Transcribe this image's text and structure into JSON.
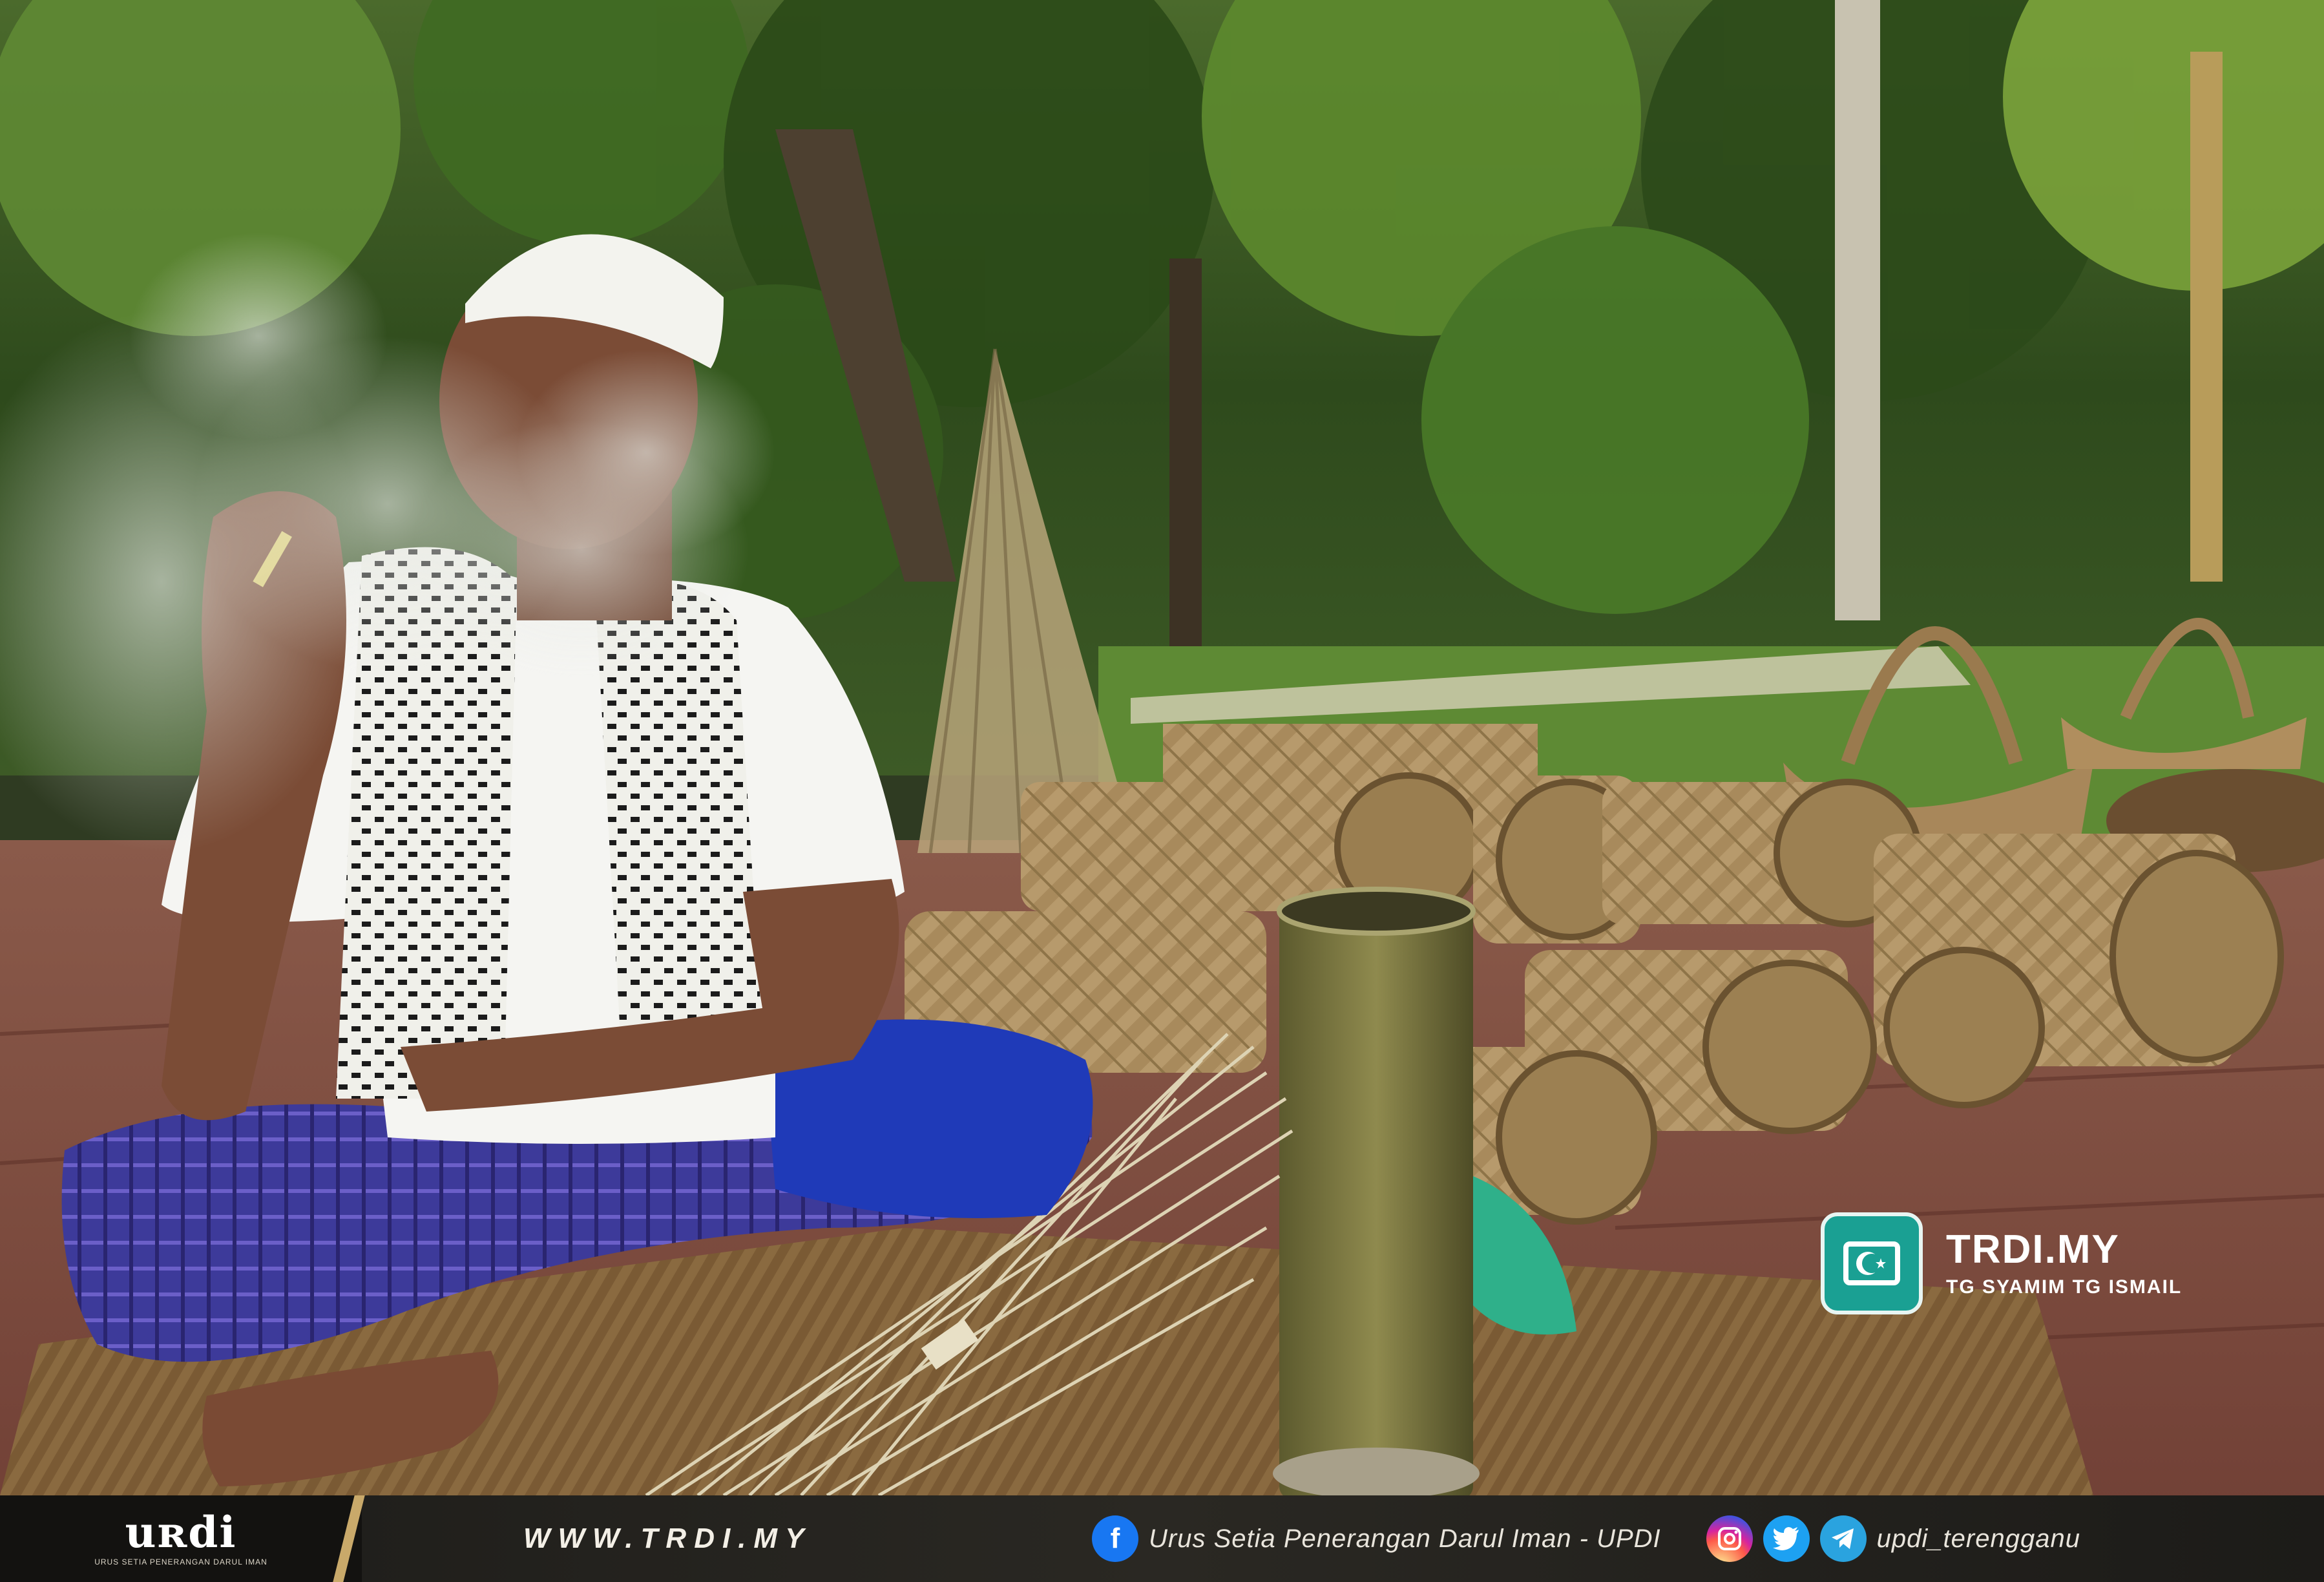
{
  "watermark": {
    "brand": "TRDI.MY",
    "credit": "TG SYAMIM TG ISMAIL",
    "badge_color": "#1aa093"
  },
  "banner": {
    "logo_text": "uʀdi",
    "logo_subtitle": "URUS SETIA PENERANGAN DARUL IMAN",
    "website": "WWW.TRDI.MY",
    "facebook_icon": "facebook-icon",
    "facebook_name": "Urus Setia Penerangan Darul Iman - UPDI",
    "social_icons": [
      "instagram-icon",
      "twitter-icon",
      "telegram-icon"
    ],
    "social_handle": "updi_terengganu"
  }
}
